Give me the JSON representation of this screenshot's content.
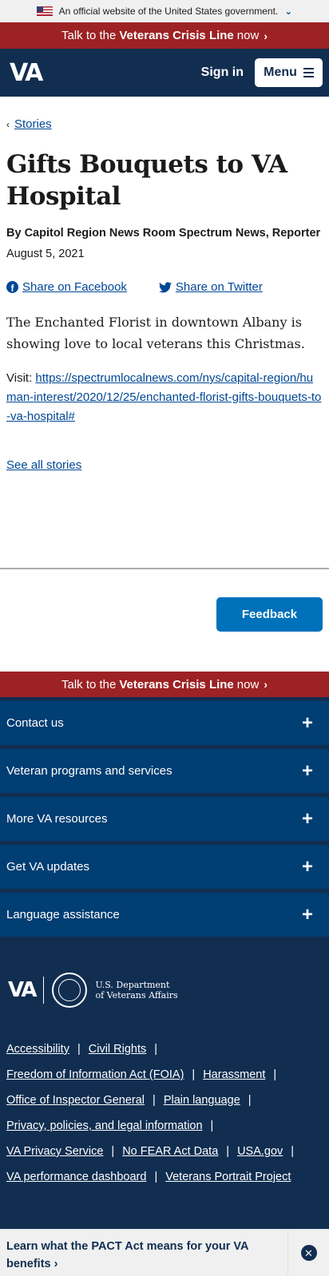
{
  "gov_banner": {
    "text": "An official website of the United States government."
  },
  "crisis_line": {
    "prefix": "Talk to the",
    "bold": "Veterans Crisis Line",
    "suffix": "now"
  },
  "header": {
    "logo": "VA",
    "signin": "Sign in",
    "menu": "Menu"
  },
  "breadcrumb": {
    "label": "Stories"
  },
  "article": {
    "title": "Gifts Bouquets to VA Hospital",
    "byline": "By Capitol Region News Room Spectrum News, Reporter",
    "date": "August 5, 2021",
    "share_facebook": "Share on Facebook",
    "share_twitter": "Share on Twitter",
    "body": "The Enchanted Florist in downtown Albany is showing love to local veterans this Christmas.",
    "visit_label": "Visit:",
    "visit_url": "https://spectrumlocalnews.com/nys/capital-region/human-interest/2020/12/25/enchanted-florist-gifts-bouquets-to-va-hospital#",
    "see_all": "See all stories"
  },
  "feedback": {
    "label": "Feedback"
  },
  "footer": {
    "sections": [
      {
        "label": "Contact us"
      },
      {
        "label": "Veteran programs and services"
      },
      {
        "label": "More VA resources"
      },
      {
        "label": "Get VA updates"
      },
      {
        "label": "Language assistance"
      }
    ],
    "logo": "VA",
    "dept_line1": "U.S. Department",
    "dept_line2": "of Veterans Affairs",
    "link_rows": [
      [
        "Accessibility",
        "Civil Rights"
      ],
      [
        "Freedom of Information Act (FOIA)",
        "Harassment"
      ],
      [
        "Office of Inspector General",
        "Plain language"
      ],
      [
        "Privacy, policies, and legal information"
      ],
      [
        "VA Privacy Service",
        "No FEAR Act Data",
        "USA.gov"
      ],
      [
        "VA performance dashboard",
        "Veterans Portrait Project"
      ]
    ]
  },
  "pact_banner": {
    "text": "Learn what the PACT Act means for your VA benefits"
  },
  "colors": {
    "navy": "#112e51",
    "crisis_red": "#9d2224",
    "link_blue": "#004795",
    "feedback_blue": "#0071bb"
  }
}
